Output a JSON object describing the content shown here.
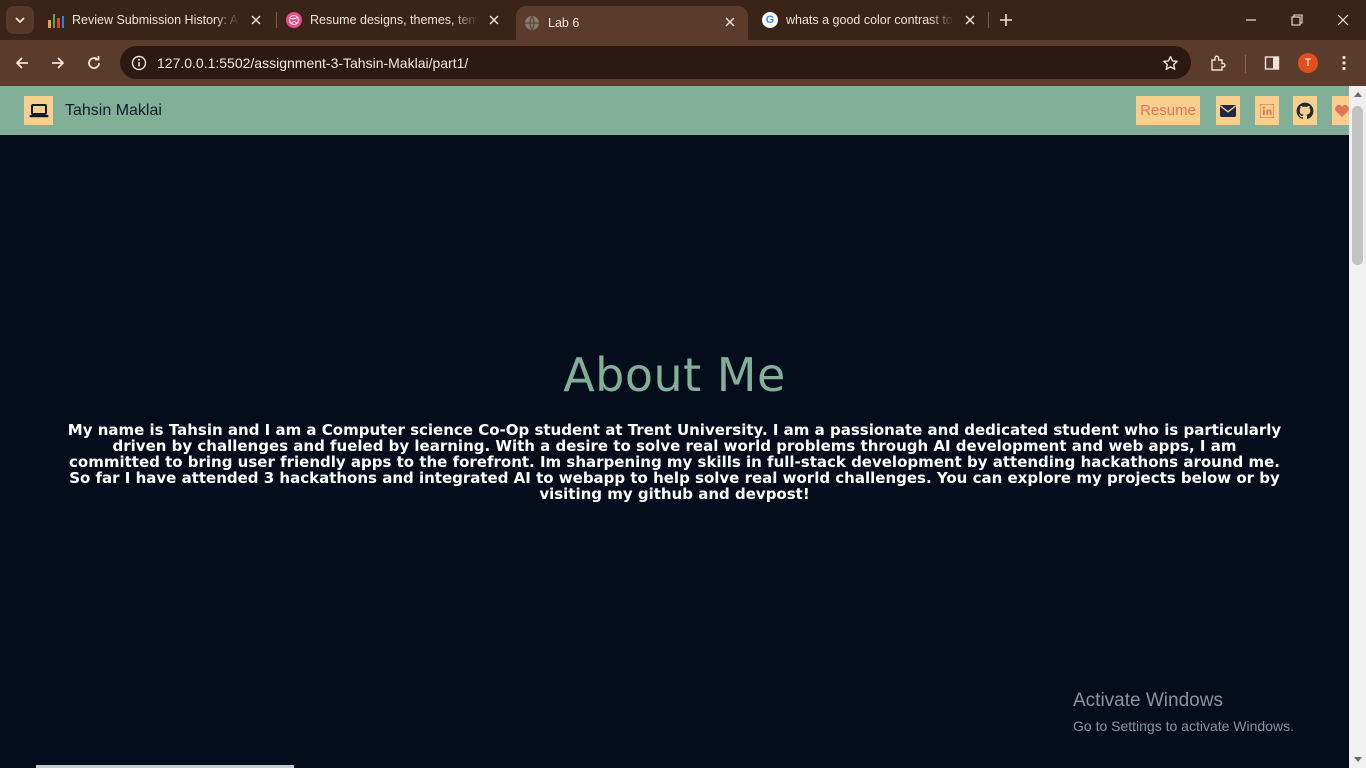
{
  "browser": {
    "tabs": [
      {
        "title": "Review Submission History: Assi",
        "icon": "bar-chart-icon"
      },
      {
        "title": "Resume designs, themes, templ",
        "icon": "dribbble-icon"
      },
      {
        "title": "Lab 6",
        "icon": "globe-icon",
        "active": true
      },
      {
        "title": "whats a good color contrast to",
        "icon": "google-icon"
      }
    ],
    "url": "127.0.0.1:5502/assignment-3-Tahsin-Maklai/part1/",
    "profile_initial": "T"
  },
  "navbar": {
    "brand_name": "Tahsin Maklai",
    "resume_label": "Resume",
    "icons": [
      "envelope-icon",
      "linkedin-icon",
      "github-icon",
      "heart-icon"
    ]
  },
  "about": {
    "heading": "About Me",
    "text": "My name is Tahsin and I am a Computer science Co-Op student at Trent University. I am a passionate and dedicated student who is particularly driven by challenges and fueled by learning. With a desire to solve real world problems through AI development and web apps, I am committed to bring user friendly apps to the forefront. Im sharpening my skills in full-stack development by attending hackathons around me. So far I have attended 3 hackathons and integrated AI to webapp to help solve real world challenges. You can explore my projects below or by visiting my github and devpost!"
  },
  "watermark": {
    "line1": "Activate Windows",
    "line2": "Go to Settings to activate Windows."
  },
  "colors": {
    "page_bg": "#050d1d",
    "navbar_bg": "#82af98",
    "accent_yellow": "#f9cf8d",
    "accent_coral": "#e07658",
    "heading_green": "#82af98",
    "chrome_dark": "#3a2418",
    "chrome_toolbar": "#5a3b2c"
  }
}
